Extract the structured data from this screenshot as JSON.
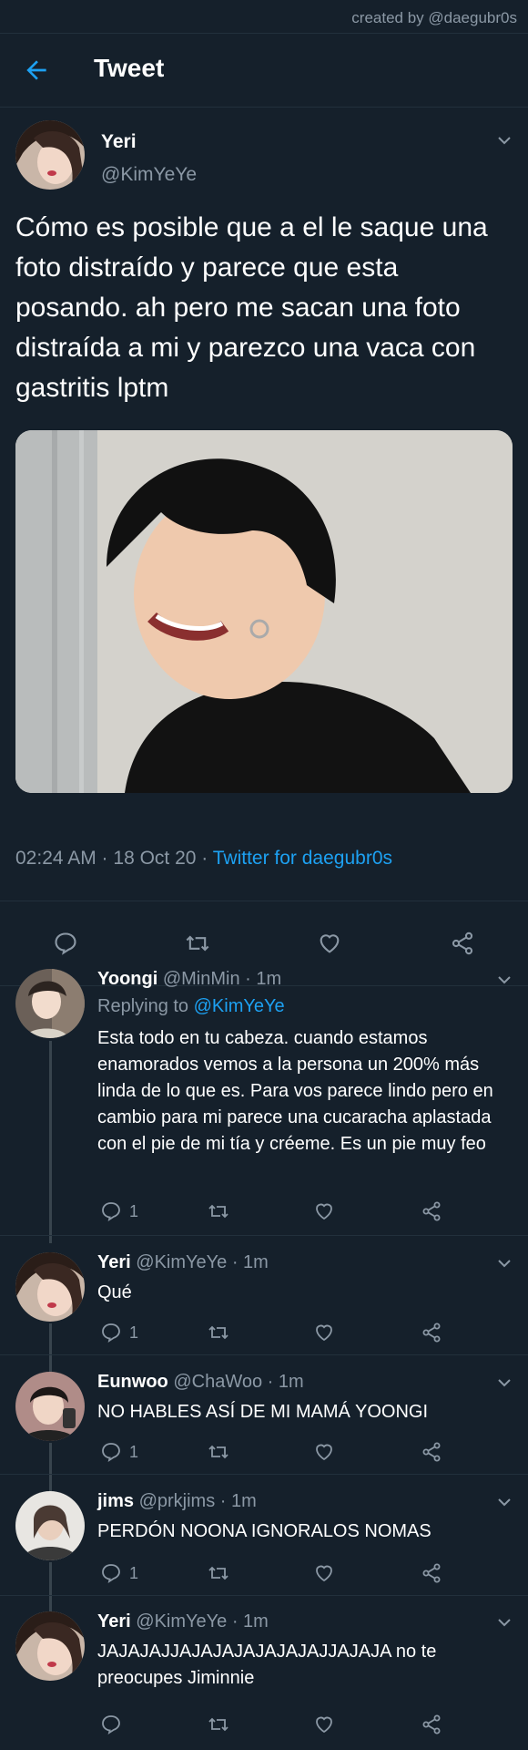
{
  "credit": "created by @daegubr0s",
  "topbar": {
    "title": "Tweet"
  },
  "main_tweet": {
    "name": "Yeri",
    "handle": "@KimYeYe",
    "text": "Cómo es posible que a el le saque una foto distraído y parece que esta posando. ah pero me sacan una foto distraída a mi y parezco una vaca con gastritis lptm",
    "time": "02:24 AM · 18 Oct 20 · ",
    "client": "Twitter for daegubr0s"
  },
  "replies": [
    {
      "name": "Yoongi",
      "meta": " @MinMin · 1m",
      "replying_prefix": "Replying to ",
      "replying_to": "@KimYeYe",
      "text": "Esta todo en tu cabeza. cuando estamos enamorados vemos a la persona un 200% más linda de lo que es. Para vos parece lindo pero en cambio para mi parece una cucaracha aplastada con el pie de mi tía y créeme. Es un pie muy feo",
      "reply_count": "1"
    },
    {
      "name": "Yeri",
      "meta": " @KimYeYe · 1m",
      "text": "Qué",
      "reply_count": "1"
    },
    {
      "name": "Eunwoo",
      "meta": " @ChaWoo · 1m",
      "text": "NO HABLES ASÍ DE MI MAMÁ YOONGI",
      "reply_count": "1"
    },
    {
      "name": "jims",
      "meta": " @prkjims · 1m",
      "text": "PERDÓN NOONA IGNORALOS NOMAS",
      "reply_count": "1"
    },
    {
      "name": "Yeri",
      "meta": " @KimYeYe · 1m",
      "text": "JAJAJAJJAJAJAJAJAJAJAJJAJAJA no te preocupes Jiminnie",
      "reply_count": ""
    }
  ],
  "colors": {
    "background": "#15202b",
    "accent": "#1da1f2",
    "muted": "#8b98a5"
  }
}
